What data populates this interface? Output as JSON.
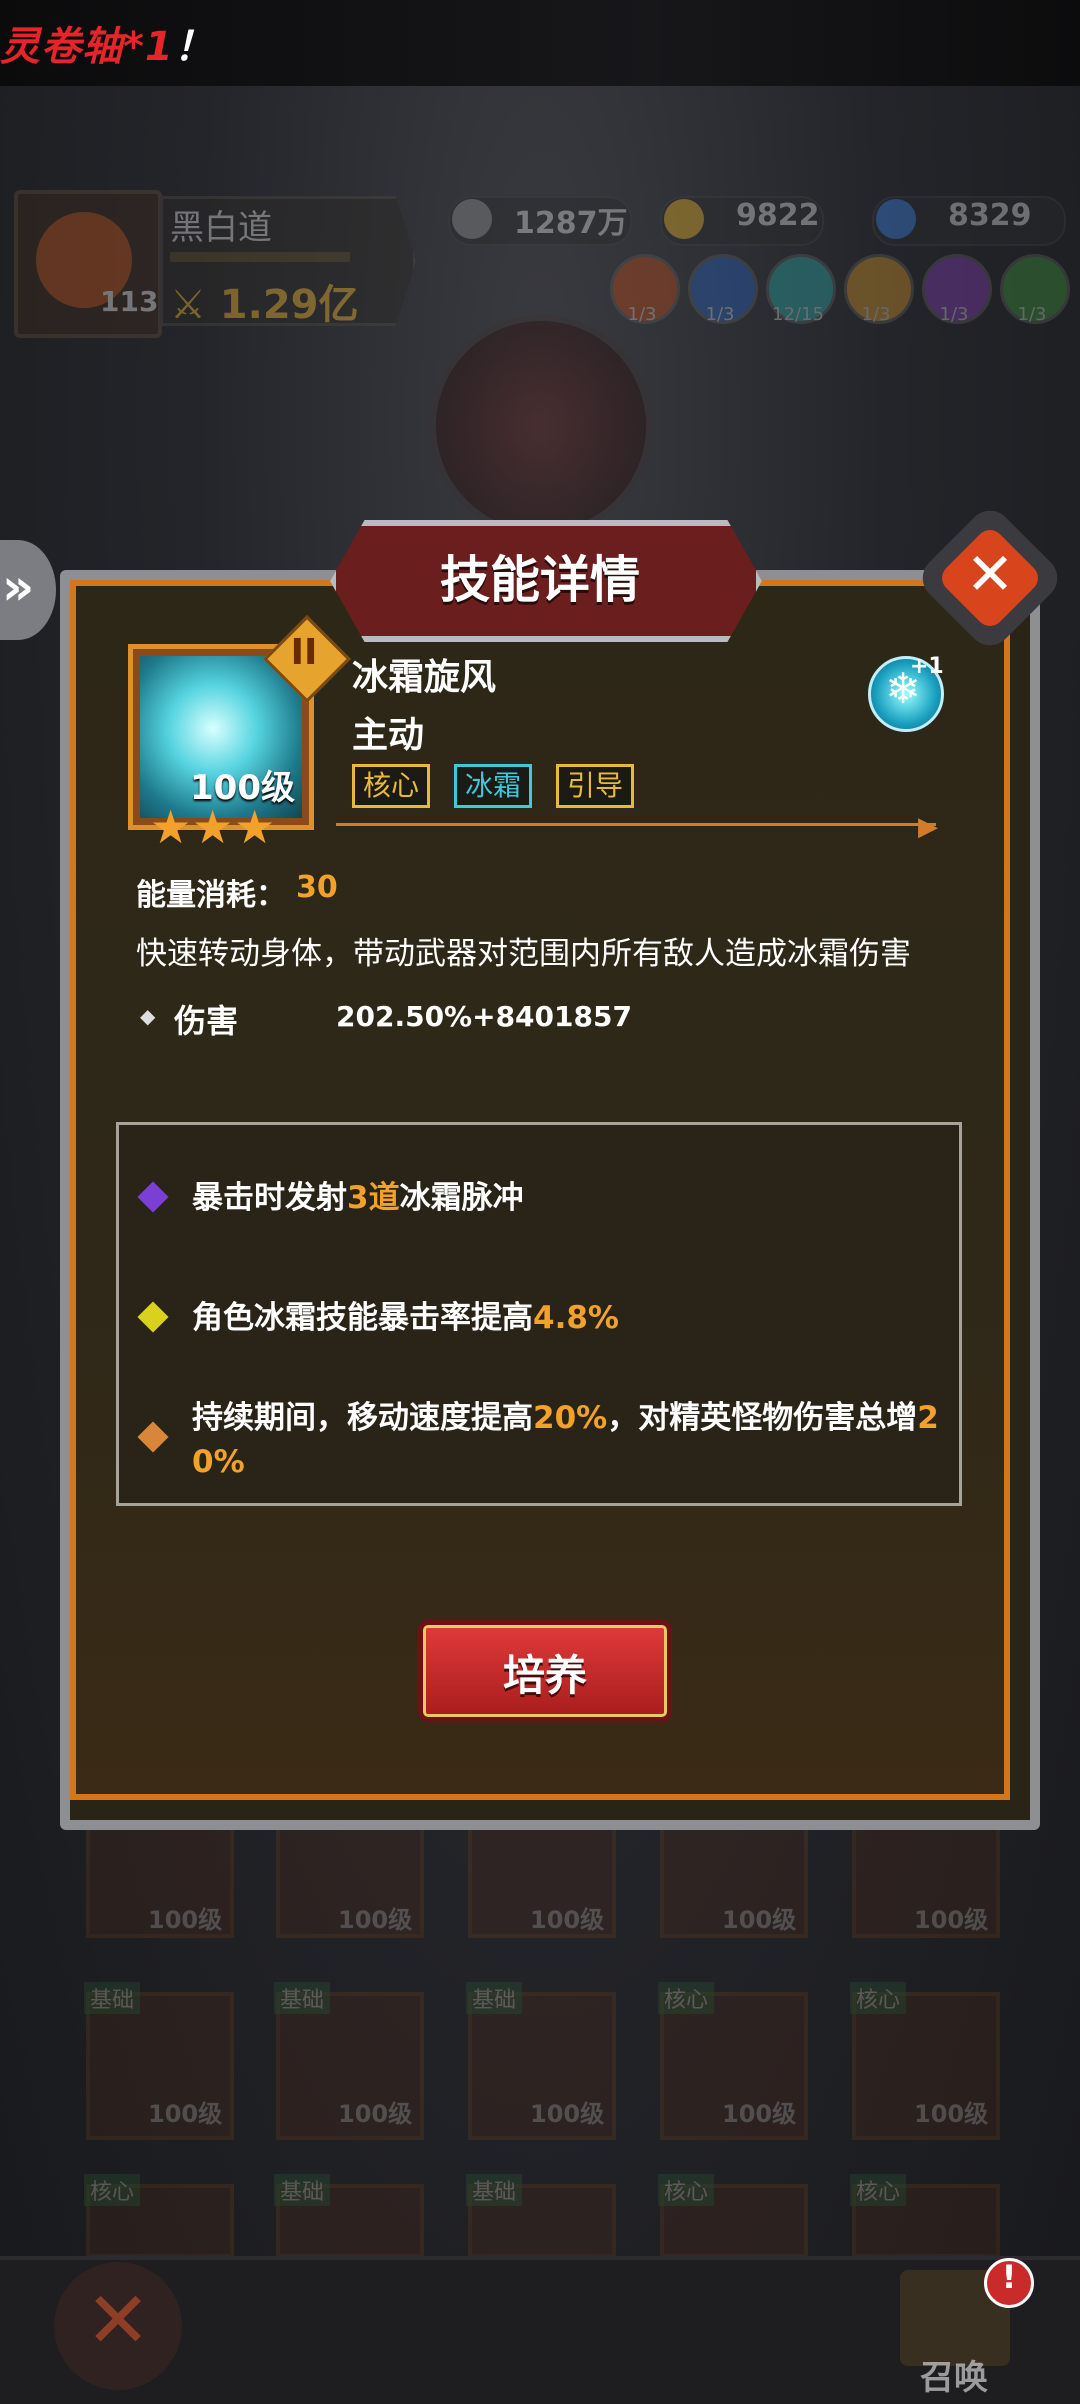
{
  "banner": {
    "text": "灵卷轴*1",
    "bang": "！"
  },
  "player": {
    "name": "黑白道",
    "level": "113",
    "power": "1.29亿"
  },
  "resources": [
    {
      "icon": "coin-icon",
      "value": "1287万",
      "color": "#8a8a8a"
    },
    {
      "icon": "gold-coin-icon",
      "value": "9822",
      "color": "#d7a52a"
    },
    {
      "icon": "gem-icon",
      "value": "8329",
      "color": "#3a7bd5"
    }
  ],
  "elements": [
    {
      "icon": "fire-element-icon",
      "count": "1/3",
      "color": "#b0481c"
    },
    {
      "icon": "lightning-element-icon",
      "count": "1/3",
      "color": "#2a5cb0"
    },
    {
      "icon": "ice-element-icon",
      "count": "12/15",
      "color": "#2a9c9c"
    },
    {
      "icon": "light-element-icon",
      "count": "1/3",
      "color": "#c08a2a"
    },
    {
      "icon": "dark-element-icon",
      "count": "1/3",
      "color": "#7a3aa8"
    },
    {
      "icon": "poison-element-icon",
      "count": "1/3",
      "color": "#3a8a3a"
    }
  ],
  "modal": {
    "title": "技能详情",
    "close_symbol": "✕",
    "side_symbol": "»",
    "skill": {
      "name": "冰霜旋风",
      "type": "主动",
      "level": "100级",
      "tier": "II",
      "stars": 3,
      "tags": [
        {
          "label": "核心",
          "color": "#e8b93a"
        },
        {
          "label": "冰霜",
          "color": "#3fc9d9"
        },
        {
          "label": "引导",
          "color": "#e8b93a"
        }
      ],
      "rune_symbol": "❄",
      "rune_plus": "+1"
    },
    "energy_label": "能量消耗：",
    "energy_value": "30",
    "description": "快速转动身体，带动武器对范围内所有敌人造成冰霜伤害",
    "damage_label": "伤害",
    "damage_value": "202.50%+8401857",
    "effects": [
      {
        "color": "#7c3fd6",
        "pre": "暴击时发射",
        "hl": "3道",
        "post": "冰霜脉冲"
      },
      {
        "color": "#d9d21c",
        "pre": "角色冰霜技能暴击率提高",
        "hl": "4.8%",
        "post": ""
      },
      {
        "color": "#d8873a",
        "pre": "持续期间，移动速度提高",
        "hl": "20%",
        "post": "，对精英怪物伤害总增",
        "hl2": "20%"
      }
    ],
    "button_label": "培养"
  },
  "grid": {
    "row1_levels": [
      "100级",
      "100级",
      "100级",
      "100级",
      "100级"
    ],
    "row2": [
      {
        "tag": "基础",
        "level": "100级"
      },
      {
        "tag": "基础",
        "level": "100级"
      },
      {
        "tag": "基础",
        "level": "100级"
      },
      {
        "tag": "核心",
        "level": "100级"
      },
      {
        "tag": "核心",
        "level": "100级"
      }
    ],
    "row3_tags": [
      "核心",
      "基础",
      "基础",
      "核心",
      "核心"
    ]
  },
  "bottom": {
    "close_symbol": "✕",
    "summon_label": "召唤",
    "alert": "!"
  }
}
